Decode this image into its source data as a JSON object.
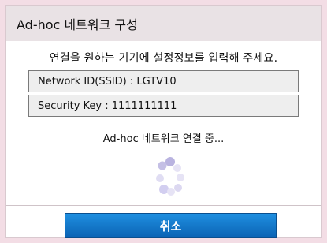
{
  "dialog": {
    "title": "Ad-hoc 네트워크 구성",
    "instruction": "연결을 원하는 기기에 설정정보를 입력해 주세요.",
    "network_id": "Network ID(SSID) : LGTV10",
    "security_key": "Security Key : 1111111111",
    "status": "Ad-hoc 네트워크 연결 중...",
    "spinner_icon": "loading-spinner-icon",
    "cancel_label": "취소"
  },
  "colors": {
    "background": "#f3dde5",
    "title_bar": "#e9e2e5",
    "field_bg": "#eeeeee",
    "button_top": "#1f8fe0",
    "button_bottom": "#0b63b4",
    "spinner_dark": "#b9b3e0",
    "spinner_light": "#e6e3f5"
  }
}
